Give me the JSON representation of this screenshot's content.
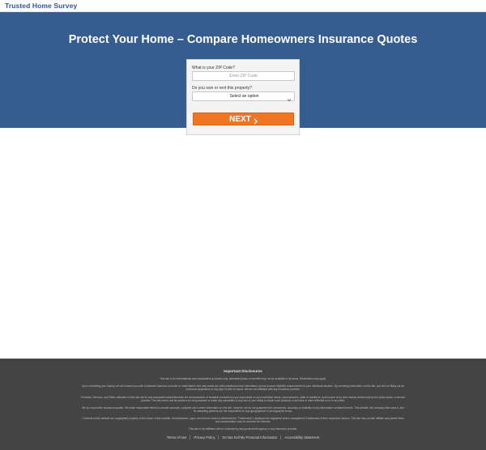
{
  "header": {
    "brand": "Trusted Home Survey"
  },
  "hero": {
    "title": "Protect Your Home – Compare Homeowners Insurance Quotes"
  },
  "form": {
    "zip_label": "What is your ZIP Code?",
    "zip_placeholder": "Enter ZIP Code",
    "zip_value": "",
    "own_label": "Do you own or rent this property?",
    "own_selected": "Select an option",
    "next_label": "NEXT"
  },
  "colors": {
    "brand": "#2f5597",
    "hero_background": "#365d90",
    "button": "#ef7623",
    "footer_background": "#444444"
  },
  "icons": {
    "select_chevron": "chevron-down-icon",
    "next_chevron": "chevron-right-icon"
  },
  "footer": {
    "heading": "Important Disclosures",
    "paragraphs": [
      "This site is for informational and comparative purposes only, advertised plans or benefits may not be available in all areas. Restrictions may apply.",
      "Upon submitting your inquiry, we will connect you with a licensed insurance provider or marketplace who may assist you with potential product information, and/or product eligibility requirements for your individual situation. By providing information on this site, you are not filling out an insurance application or any type of offer to insure. We are not affiliated with any insurance provider.",
      "Products, Services, and Rates reflected on this site are for any associated advertisements are demonstrative of available products but you may based on your individual needs, circumstances, state of residence, and income or by other factors determined by the policy issuer or service provider. The site owner and its partners do not guarantee or make any warranties of any sort of your ability to obtain such products or services or rates reflected on or in any sites.",
      "We do not provide insurance quotes. We make reasonable efforts to provide accurate, complete and current information on this site, however, we do not guarantee the correctness, accuracy or reliability of any information contained herein. This website, the company that owns it, and its marketing partners are not responsible for any typographical or photographic errors.",
      "Contents of this website are copyrighted property of the owner of this website. All trademarks, logos, and service marks (collectively the \"Trademarks\") displayed are registered and/or unregistered Trademarks of their respective owners. This site may contain affiliate and partner links and compensation may be received for referrals.",
      "This site is not affiliated with or endorsed by any government agency or any insurance provider."
    ],
    "links": [
      "Terms of Use",
      "Privacy Policy",
      "Do Not Sell My Personal Information",
      "Accessibility Statement"
    ]
  }
}
